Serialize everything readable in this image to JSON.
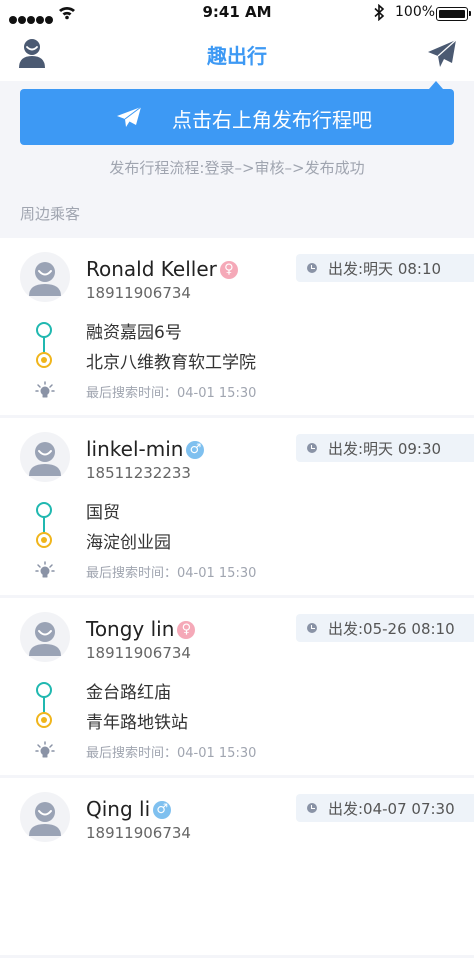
{
  "status_bar": {
    "time": "9:41 AM",
    "battery": "100%"
  },
  "nav": {
    "title": "趣出行"
  },
  "banner": {
    "label": "点击右上角发布行程吧"
  },
  "flow_hint": "发布行程流程:登录–>审核–>发布成功",
  "section_title": "周边乘客",
  "colors": {
    "accent": "#3d99f4",
    "start_dot": "#20b8b0",
    "end_dot": "#f0b51c",
    "female": "#f5a9b8",
    "male": "#7fc0ef"
  },
  "passengers": [
    {
      "name": "Ronald Keller",
      "gender": "female",
      "gender_symbol": "♀",
      "phone": "18911906734",
      "depart": "出发:明天 08:10",
      "from": "融资嘉园6号",
      "to": "北京八维教育软工学院",
      "last_search": "最后搜索时间：04-01 15:30"
    },
    {
      "name": "linkel-min",
      "gender": "male",
      "gender_symbol": "♂",
      "phone": "18511232233",
      "depart": "出发:明天 09:30",
      "from": "国贸",
      "to": "海淀创业园",
      "last_search": "最后搜索时间：04-01 15:30"
    },
    {
      "name": "Tongy lin",
      "gender": "female",
      "gender_symbol": "♀",
      "phone": "18911906734",
      "depart": "出发:05-26 08:10",
      "from": "金台路红庙",
      "to": "青年路地铁站",
      "last_search": "最后搜索时间：04-01 15:30"
    },
    {
      "name": "Qing li",
      "gender": "male",
      "gender_symbol": "♂",
      "phone": "18911906734",
      "depart": "出发:04-07 07:30",
      "from": "",
      "to": "",
      "last_search": ""
    }
  ]
}
